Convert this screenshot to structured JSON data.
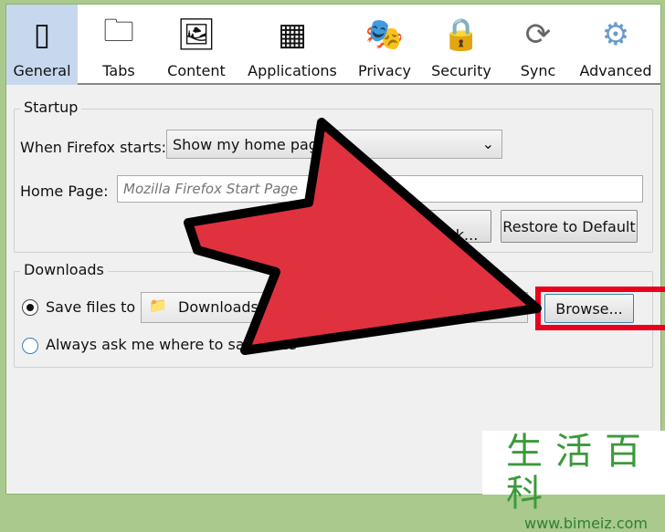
{
  "toolbar": {
    "tabs": [
      {
        "label": "General",
        "icon": "switch-icon",
        "selected": true
      },
      {
        "label": "Tabs",
        "icon": "tabs-icon"
      },
      {
        "label": "Content",
        "icon": "content-icon"
      },
      {
        "label": "Applications",
        "icon": "applications-icon"
      },
      {
        "label": "Privacy",
        "icon": "mask-icon"
      },
      {
        "label": "Security",
        "icon": "lock-icon"
      },
      {
        "label": "Sync",
        "icon": "sync-icon"
      },
      {
        "label": "Advanced",
        "icon": "gear-icon"
      }
    ]
  },
  "startup": {
    "title": "Startup",
    "when_label": "When Firefox starts:",
    "when_value": "Show my home page",
    "home_label": "Home Page:",
    "home_placeholder": "Mozilla Firefox Start Page",
    "bookmark_button": "Use Bookmark...",
    "restore_button": "Restore to Default"
  },
  "downloads": {
    "title": "Downloads",
    "save_label": "Save files to",
    "save_checked": true,
    "folder": "Downloads",
    "browse_button": "Browse...",
    "ask_label": "Always ask me where to save files",
    "ask_checked": false
  },
  "highlight_color": "#e8001c",
  "arrow_color": "#e0313f",
  "watermark": {
    "chars": "生活百科",
    "url": "www.bimeiz.com"
  }
}
